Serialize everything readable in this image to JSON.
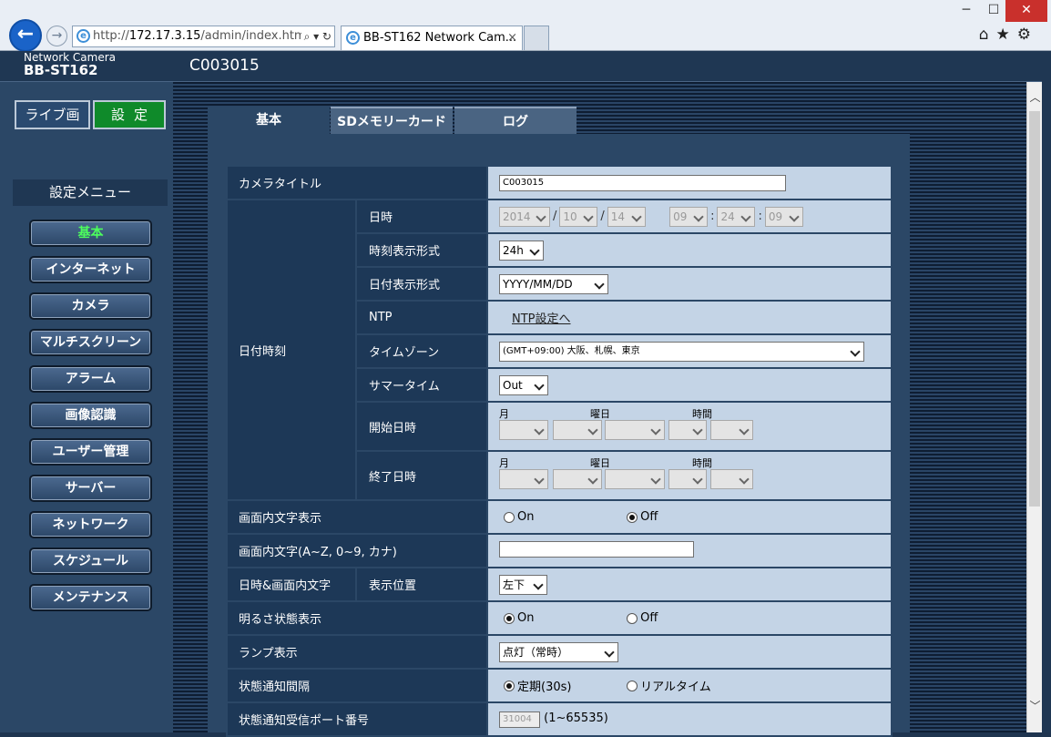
{
  "browser": {
    "address_host": "172.17.3.15",
    "address_path": "/admin/index.htm",
    "address_scheme": "http://",
    "tab_title": "BB-ST162 Network Cam...",
    "ie_glyph": "e"
  },
  "camera": {
    "brand_line1": "Network Camera",
    "brand_line2": "BB-ST162",
    "title": "C003015"
  },
  "sidebar": {
    "live_label": "ライブ画",
    "settings_label": "設定",
    "menu_header": "設定メニュー",
    "items": [
      {
        "label": "基本"
      },
      {
        "label": "インターネット"
      },
      {
        "label": "カメラ"
      },
      {
        "label": "マルチスクリーン"
      },
      {
        "label": "アラーム"
      },
      {
        "label": "画像認識"
      },
      {
        "label": "ユーザー管理"
      },
      {
        "label": "サーバー"
      },
      {
        "label": "ネットワーク"
      },
      {
        "label": "スケジュール"
      },
      {
        "label": "メンテナンス"
      }
    ]
  },
  "tabs": [
    {
      "label": "基本"
    },
    {
      "label": "SDメモリーカード"
    },
    {
      "label": "ログ"
    }
  ],
  "form": {
    "camera_title_label": "カメラタイトル",
    "camera_title_value": "C003015",
    "datetime_group": "日付時刻",
    "datetime_label": "日時",
    "year": "2014",
    "month": "10",
    "day": "14",
    "hour": "09",
    "minute": "24",
    "second": "09",
    "date_sep": "/",
    "time_sep": ":",
    "time_format_label": "時刻表示形式",
    "time_format_value": "24h",
    "date_format_label": "日付表示形式",
    "date_format_value": "YYYY/MM/DD",
    "ntp_label": "NTP",
    "ntp_link": "NTP設定へ",
    "timezone_label": "タイムゾーン",
    "timezone_value": "(GMT+09:00) 大阪、札幌、東京",
    "summer_label": "サマータイム",
    "summer_value": "Out",
    "start_label": "開始日時",
    "end_label": "終了日時",
    "month_h": "月",
    "weekday_h": "曜日",
    "time_h": "時間",
    "osd_label": "画面内文字表示",
    "on": "On",
    "off": "Off",
    "osd_text_label": "画面内文字(A~Z, 0~9, カナ)",
    "osd_pos_group": "日時&画面内文字",
    "osd_pos_label": "表示位置",
    "osd_pos_value": "左下",
    "brightness_label": "明るさ状態表示",
    "lamp_label": "ランプ表示",
    "lamp_value": "点灯（常時）",
    "notify_label": "状態通知間隔",
    "notify_periodic": "定期(30s)",
    "notify_realtime": "リアルタイム",
    "port_label": "状態通知受信ポート番号",
    "port_value": "31004",
    "port_range": "(1~65535)"
  }
}
